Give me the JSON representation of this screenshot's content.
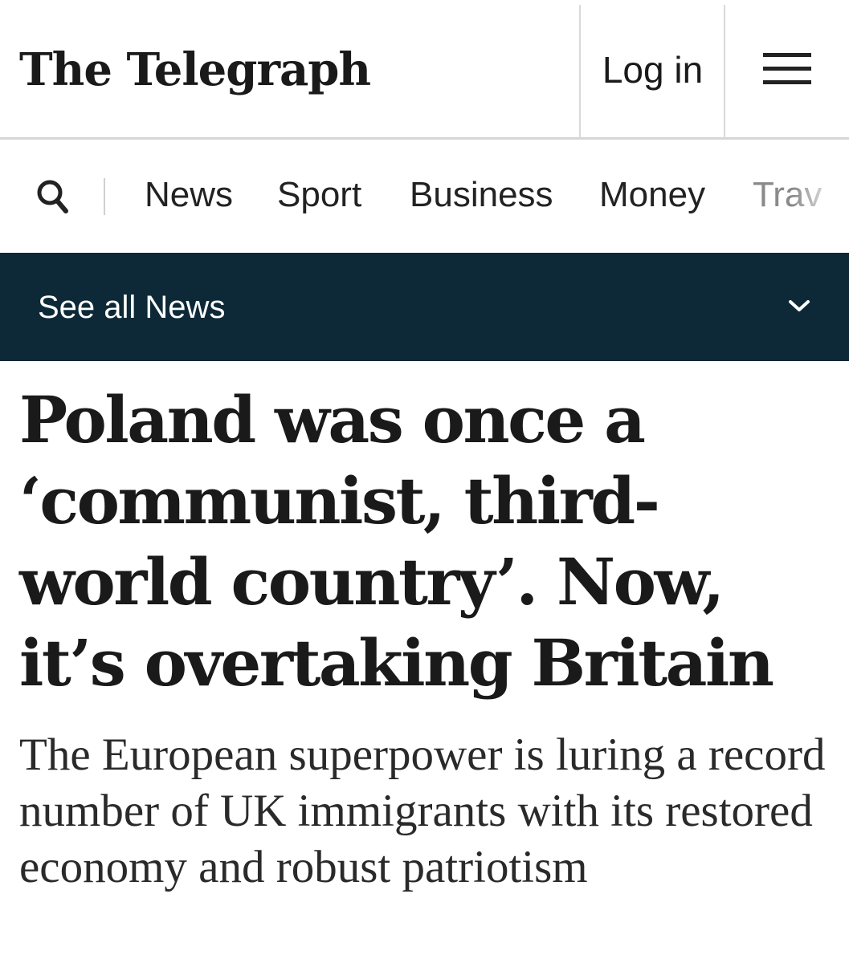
{
  "header": {
    "logo_text": "The Telegraph",
    "login_label": "Log in",
    "menu_icon": "hamburger-menu-icon"
  },
  "section_nav": {
    "search_icon": "search-icon",
    "items": [
      {
        "label": "News"
      },
      {
        "label": "Sport"
      },
      {
        "label": "Business"
      },
      {
        "label": "Money"
      },
      {
        "label": "Trav"
      }
    ]
  },
  "see_all_bar": {
    "label": "See all News",
    "icon": "chevron-down-icon",
    "background_color": "#0d2938"
  },
  "article": {
    "headline": "Poland was once a ‘communist, third-world country’. Now, it’s overtaking Britain",
    "standfirst": "The European superpower is luring a record number of UK immigrants with its restored economy and robust patriotism"
  }
}
